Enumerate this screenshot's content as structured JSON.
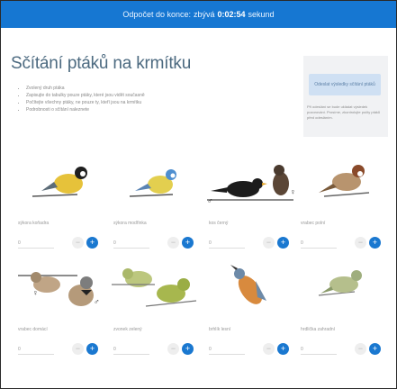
{
  "topbar": {
    "prefix": "Odpočet do konce:",
    "middle": "zbývá",
    "count": "0:02:54",
    "suffix": "sekund"
  },
  "page": {
    "title": "Sčítání ptáků na krmítku",
    "bullets": [
      "Zvolený druh ptáka",
      "Zapisujte do tabulky pouze ptáky, které jsou vidět současně",
      "Počítejte všechny ptáky, ne pouze ty, kteří jsou na krmítku",
      "Podrobnosti o sčítání naleznete"
    ]
  },
  "sidebar": {
    "send_label": "Odeslat výsledky sčítání ptáků",
    "note": "Při odeslání se bude ukládat výsledek pozorování. Prosíme, zkontrolujte počty ptáků před odesláním."
  },
  "birds": [
    {
      "name": "sýkora koňadra",
      "qty": "0",
      "colors": {
        "body": "#e6c23a",
        "head": "#1f1f1f"
      }
    },
    {
      "name": "sýkora modřinka",
      "qty": "0",
      "colors": {
        "body": "#e3cf4f",
        "head": "#4f8fd0"
      }
    },
    {
      "name": "kos černý",
      "qty": "0",
      "colors": {
        "body": "#1c1c1c",
        "head": "#1c1c1c"
      }
    },
    {
      "name": "vrabec polní",
      "qty": "0",
      "colors": {
        "body": "#b8946e",
        "head": "#8a4a2a"
      }
    },
    {
      "name": "vrabec domácí",
      "qty": "0",
      "colors": {
        "body": "#b59a7a",
        "head": "#7d7d7d"
      }
    },
    {
      "name": "zvonek zelený",
      "qty": "0",
      "colors": {
        "body": "#a7b74e",
        "head": "#9aad45"
      }
    },
    {
      "name": "brhlík lesní",
      "qty": "0",
      "colors": {
        "body": "#d88a3e",
        "head": "#6d8aa8"
      }
    },
    {
      "name": "hrdlička zahradní",
      "qty": "0",
      "colors": {
        "body": "#b5bf8c",
        "head": "#9fae7e"
      }
    }
  ],
  "controls": {
    "minus": "−",
    "plus": "+"
  },
  "sex_marks": {
    "female": "♀",
    "male": "♂"
  }
}
